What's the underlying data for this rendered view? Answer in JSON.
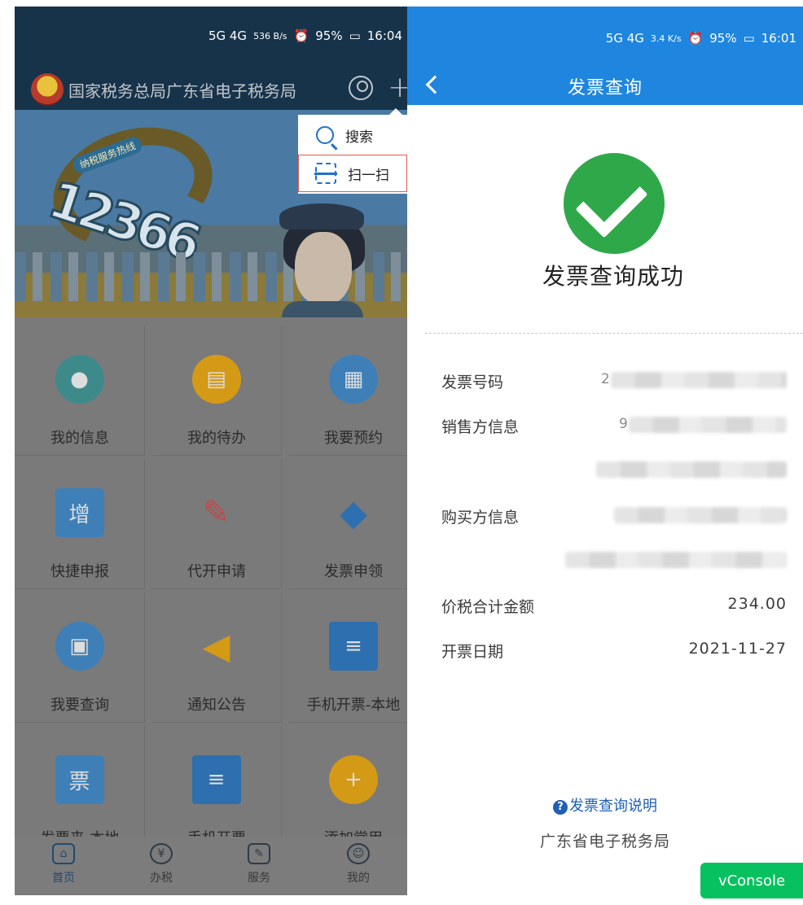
{
  "left": {
    "status": {
      "signal": "5G 4G",
      "speed": "536 B/s",
      "battery": "95%",
      "time": "16:04"
    },
    "header": {
      "title": "国家税务总局广东省电子税务局"
    },
    "banner": {
      "tag": "纳税服务热线",
      "hotline": "12366"
    },
    "popup": {
      "items": [
        {
          "label": "搜索"
        },
        {
          "label": "扫一扫"
        }
      ]
    },
    "grid": [
      {
        "label": "我的信息",
        "color": "#3e8a8a",
        "icon": "user-icon"
      },
      {
        "label": "我的待办",
        "color": "#d49a16",
        "icon": "todo-icon"
      },
      {
        "label": "我要预约",
        "color": "#3e7fb8",
        "icon": "calendar-icon"
      },
      {
        "label": "快捷申报",
        "color": "#3e7fb8",
        "icon": "declare-icon"
      },
      {
        "label": "代开申请",
        "color": "#c24a4a",
        "icon": "edit-icon"
      },
      {
        "label": "发票申领",
        "color": "#2e6fb0",
        "icon": "layers-icon"
      },
      {
        "label": "我要查询",
        "color": "#3e7fb8",
        "icon": "monitor-search-icon"
      },
      {
        "label": "通知公告",
        "color": "#d49a16",
        "icon": "speaker-icon"
      },
      {
        "label": "手机开票-本地",
        "color": "#2e6fb0",
        "icon": "invoice-printer-icon"
      },
      {
        "label": "发票来-本地",
        "color": "#3e7fb8",
        "icon": "ticket-icon"
      },
      {
        "label": "手机开票",
        "color": "#2e6fb0",
        "icon": "invoice-printer-icon"
      },
      {
        "label": "添加常用",
        "color": "#d49a16",
        "icon": "add-circle-icon"
      }
    ],
    "tabs": [
      {
        "label": "首页",
        "glyph": "⌂"
      },
      {
        "label": "办税",
        "glyph": "¥"
      },
      {
        "label": "服务",
        "glyph": "✎"
      },
      {
        "label": "我的",
        "glyph": "☺"
      }
    ]
  },
  "right": {
    "status": {
      "signal": "5G 4G",
      "speed": "3.4 K/s",
      "battery": "95%",
      "time": "16:01"
    },
    "nav": {
      "title": "发票查询"
    },
    "result": {
      "text": "发票查询成功"
    },
    "rows": {
      "invoice_no": {
        "key": "发票号码",
        "lead": "2"
      },
      "seller": {
        "key": "销售方信息",
        "lead": "9"
      },
      "buyer": {
        "key": "购买方信息"
      },
      "amount": {
        "key": "价税合计金额",
        "value": "234.00"
      },
      "date": {
        "key": "开票日期",
        "value": "2021-11-27"
      }
    },
    "help": "发票查询说明",
    "footer": "广东省电子税务局",
    "vconsole": "vConsole"
  }
}
